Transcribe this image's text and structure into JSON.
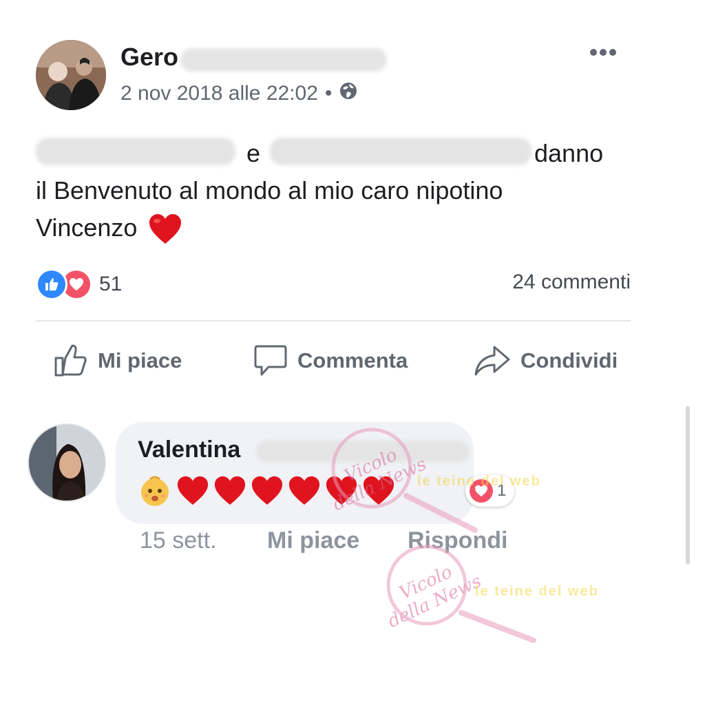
{
  "post": {
    "author_name": "Gero",
    "timestamp": "2 nov 2018 alle 22:02",
    "separator": "•",
    "privacy_icon": "globe-icon",
    "text_line1_conj": "e",
    "text_line1_end": "danno",
    "text_line2": "il Benvenuto al mondo al mio caro nipotino",
    "text_line3": "Vincenzo",
    "more_icon": "more-dots-icon"
  },
  "stats": {
    "reaction_count": "51",
    "comments_label": "24 commenti",
    "reaction_icons": [
      "like-icon",
      "love-icon"
    ]
  },
  "actions": {
    "like_label": "Mi piace",
    "comment_label": "Commenta",
    "share_label": "Condividi"
  },
  "comment": {
    "author_name": "Valentina",
    "reaction_badge_count": "1",
    "time": "15 sett.",
    "like_label": "Mi piace",
    "reply_label": "Rispondi"
  },
  "watermarks": {
    "logo_text": "Vicolo della News",
    "banner_text": "le teine del web"
  },
  "colors": {
    "like_blue": "#2e89ff",
    "love_red": "#f25268",
    "heart_red": "#e0141e",
    "text_primary": "#1c1e21",
    "text_secondary": "#606770"
  }
}
